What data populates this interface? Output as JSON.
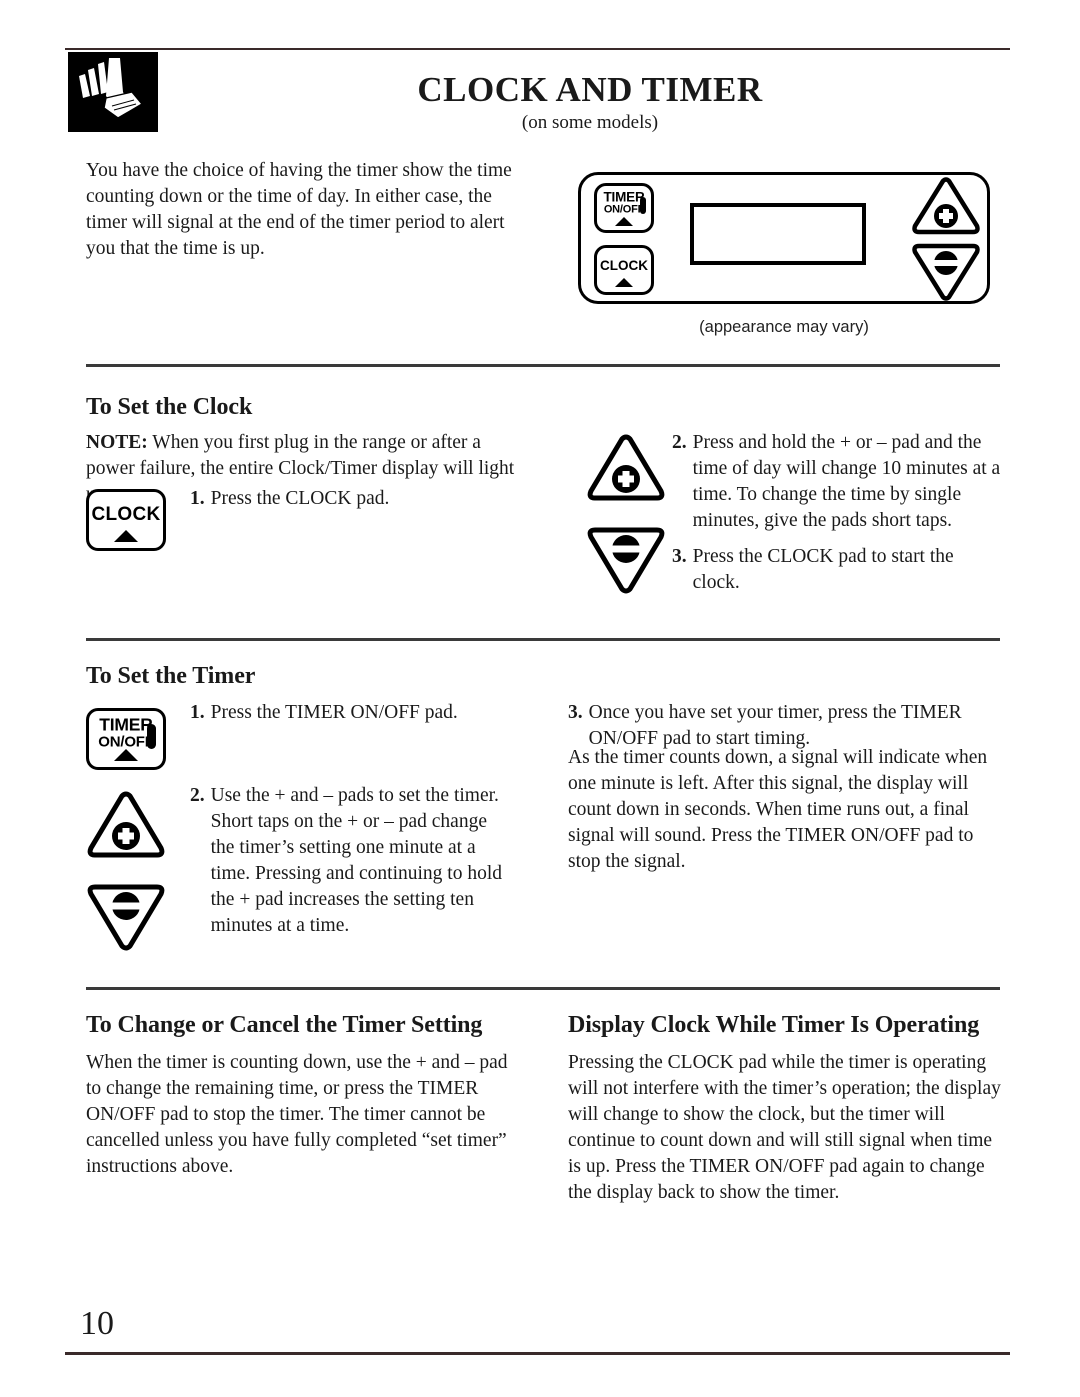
{
  "header": {
    "icon": "hand-pressing-pad-icon",
    "title": "CLOCK AND TIMER",
    "subtitle": "(on some models)"
  },
  "intro": {
    "text": "You have the choice of having the timer show the time counting down or the time of day. In either case, the timer will signal at the end of the timer period to alert you that the time is up."
  },
  "control_panel": {
    "caption": "(appearance may vary)",
    "pads": {
      "timer_line1": "TIMER",
      "timer_line2": "ON/OFF",
      "clock": "CLOCK",
      "plus": "+",
      "minus": "–"
    },
    "display": ""
  },
  "sections": {
    "set_clock": {
      "heading": "To Set the Clock",
      "note_label": "NOTE:",
      "note_text": " When you first plug in the range or after a power failure, the entire Clock/Timer display will light up.",
      "steps": [
        {
          "num": "1.",
          "text": "Press the CLOCK pad."
        },
        {
          "num": "2.",
          "text": "Press and hold the + or – pad and the time of day will change 10 minutes at a time. To change the time by single minutes, give the pads short taps."
        },
        {
          "num": "3.",
          "text": "Press the CLOCK pad to start the clock."
        }
      ],
      "pad_clock_label": "CLOCK"
    },
    "set_timer": {
      "heading": "To Set the Timer",
      "steps": [
        {
          "num": "1.",
          "text": "Press the TIMER ON/OFF pad."
        },
        {
          "num": "2.",
          "text": "Use the + and – pads to set the timer. Short taps on the + or – pad change the timer’s setting one minute at a time. Pressing and continuing to hold the + pad increases the setting ten minutes at a time."
        },
        {
          "num": "3.",
          "text": "Once you have set your timer, press the TIMER ON/OFF pad to start timing."
        }
      ],
      "trailing_text": "As the timer counts down, a signal will indicate when one minute is left. After this signal, the display will count down in seconds. When time runs out, a final signal will sound. Press the TIMER ON/OFF pad to stop the signal.",
      "pad_timer_line1": "TIMER",
      "pad_timer_line2": "ON/OFF"
    },
    "change_cancel": {
      "heading": "To Change or Cancel the Timer Setting",
      "text": "When the timer is counting down, use the + and – pad to change the remaining time, or press the TIMER ON/OFF pad to stop the timer. The timer cannot be cancelled unless you have fully completed “set timer” instructions above."
    },
    "display_clock": {
      "heading": "Display Clock While Timer Is Operating",
      "text": "Pressing the CLOCK pad while the timer is operating will not interfere with the timer’s operation; the display will change to show the clock, but the timer will continue to count down and will still signal when time is up. Press the TIMER ON/OFF pad again to change the display back to show the timer."
    }
  },
  "footer": {
    "page_number": "10"
  }
}
